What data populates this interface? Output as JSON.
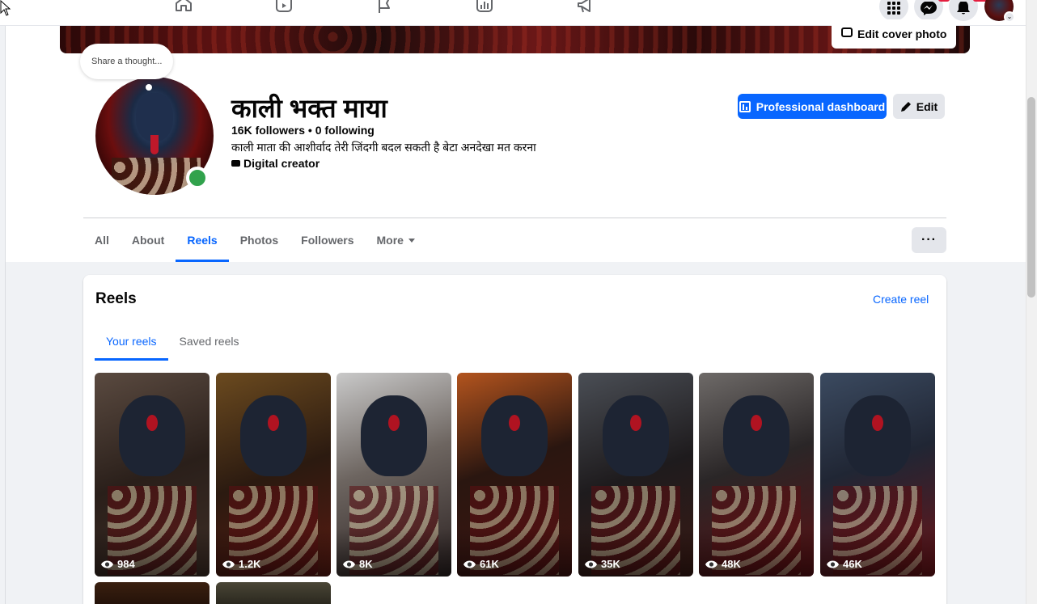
{
  "topnav": {
    "icons": [
      "home-icon",
      "reels-video-icon",
      "pages-flag-icon",
      "insights-chart-icon",
      "ads-megaphone-icon"
    ],
    "right_icons": [
      "menu-grid-icon",
      "messenger-icon",
      "notifications-bell-icon",
      "account-avatar"
    ]
  },
  "cover": {
    "edit_label": "Edit cover photo"
  },
  "thought": {
    "placeholder": "Share a thought..."
  },
  "profile": {
    "name": "काली भक्त माया",
    "stats": "16K followers • 0 following",
    "bio": "काली माता की आशीर्वाद तेरी जिंदगी बदल सकती है बेटा अनदेखा मत करना",
    "category": "Digital creator"
  },
  "actions": {
    "dashboard_label": "Professional dashboard",
    "edit_label": "Edit"
  },
  "tabs": [
    {
      "label": "All"
    },
    {
      "label": "About"
    },
    {
      "label": "Reels"
    },
    {
      "label": "Photos"
    },
    {
      "label": "Followers"
    },
    {
      "label": "More"
    }
  ],
  "active_tab": "Reels",
  "reels": {
    "title": "Reels",
    "create_label": "Create reel",
    "subtabs": [
      {
        "label": "Your reels"
      },
      {
        "label": "Saved reels"
      }
    ],
    "items": [
      {
        "views": "984"
      },
      {
        "views": "1.2K"
      },
      {
        "views": "8K"
      },
      {
        "views": "61K"
      },
      {
        "views": "35K"
      },
      {
        "views": "48K"
      },
      {
        "views": "46K"
      }
    ]
  },
  "colors": {
    "accent": "#0866ff",
    "online": "#31a24c",
    "background": "#f0f2f5"
  }
}
